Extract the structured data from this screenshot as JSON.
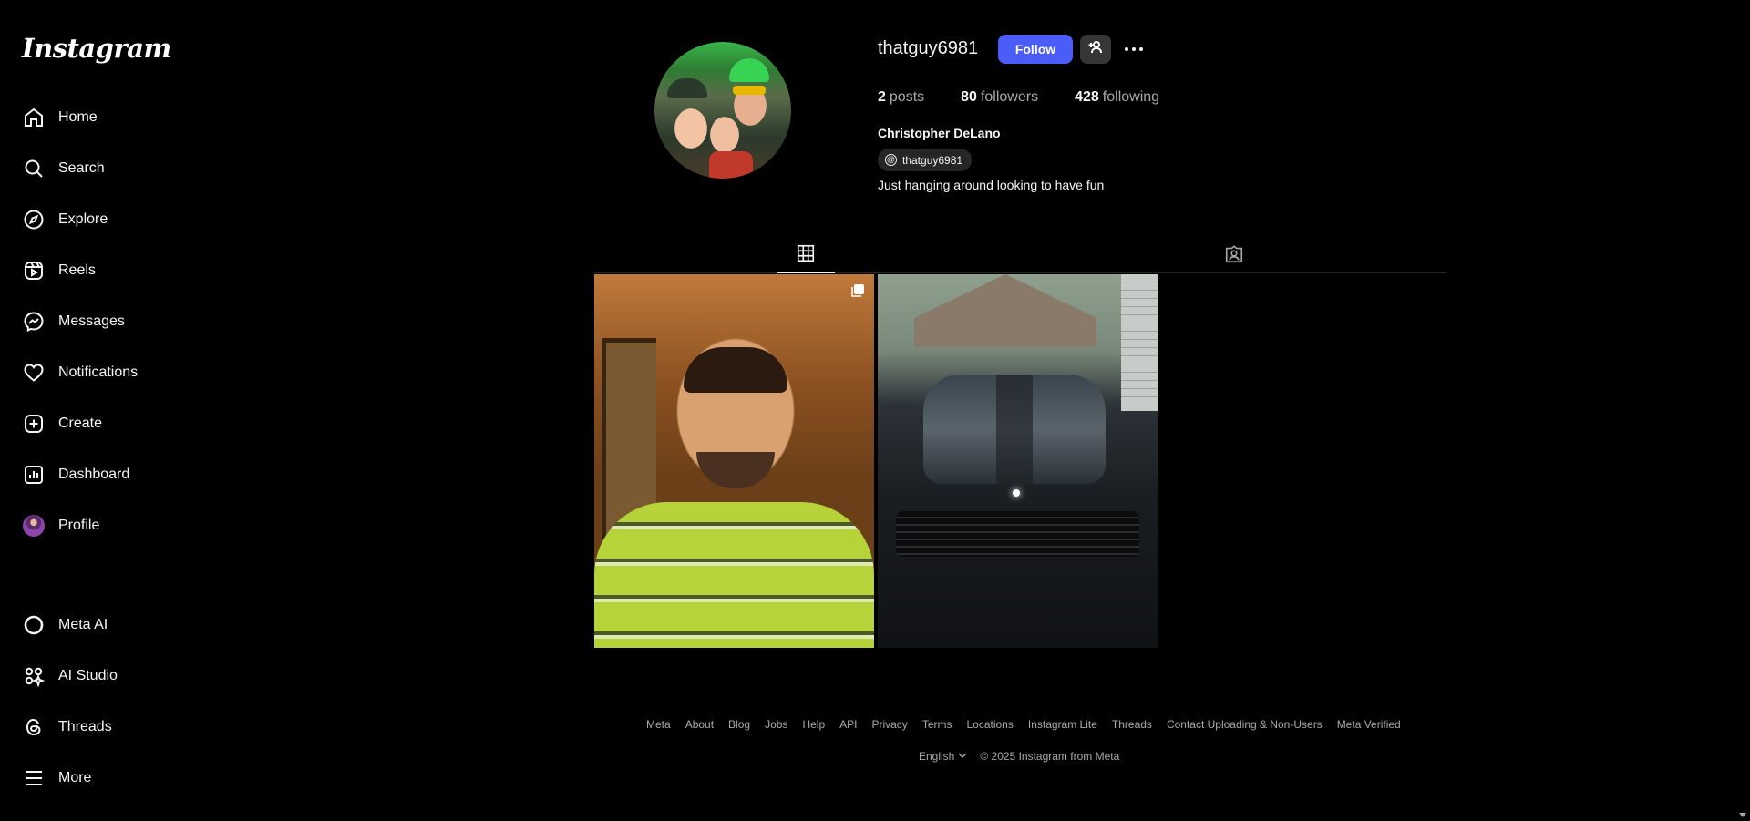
{
  "app": {
    "logo_text": "Instagram"
  },
  "sidebar": {
    "items": [
      {
        "label": "Home",
        "icon": "home-icon"
      },
      {
        "label": "Search",
        "icon": "search-icon"
      },
      {
        "label": "Explore",
        "icon": "compass-icon"
      },
      {
        "label": "Reels",
        "icon": "reels-icon"
      },
      {
        "label": "Messages",
        "icon": "messenger-icon"
      },
      {
        "label": "Notifications",
        "icon": "heart-icon"
      },
      {
        "label": "Create",
        "icon": "plus-square-icon"
      },
      {
        "label": "Dashboard",
        "icon": "chart-icon"
      },
      {
        "label": "Profile",
        "icon": "avatar"
      }
    ],
    "bottom_items": [
      {
        "label": "Meta AI",
        "icon": "meta-ai-icon"
      },
      {
        "label": "AI Studio",
        "icon": "ai-studio-icon"
      },
      {
        "label": "Threads",
        "icon": "threads-icon"
      },
      {
        "label": "More",
        "icon": "menu-icon"
      }
    ]
  },
  "profile": {
    "username": "thatguy6981",
    "follow_label": "Follow",
    "stats": {
      "posts_count": "2",
      "posts_label": "posts",
      "followers_count": "80",
      "followers_label": "followers",
      "following_count": "428",
      "following_label": "following"
    },
    "full_name": "Christopher DeLano",
    "threads_handle": "thatguy6981",
    "bio": "Just hanging around looking to have fun"
  },
  "tabs": [
    {
      "name": "posts",
      "icon": "grid-icon",
      "active": true
    },
    {
      "name": "tagged",
      "icon": "tagged-icon",
      "active": false
    }
  ],
  "footer": {
    "links": [
      "Meta",
      "About",
      "Blog",
      "Jobs",
      "Help",
      "API",
      "Privacy",
      "Terms",
      "Locations",
      "Instagram Lite",
      "Threads",
      "Contact Uploading & Non-Users",
      "Meta Verified"
    ],
    "language": "English",
    "copyright": "© 2025 Instagram from Meta"
  },
  "colors": {
    "follow_button": "#4a5df9",
    "background": "#000000",
    "muted_text": "#a8a8a8"
  }
}
